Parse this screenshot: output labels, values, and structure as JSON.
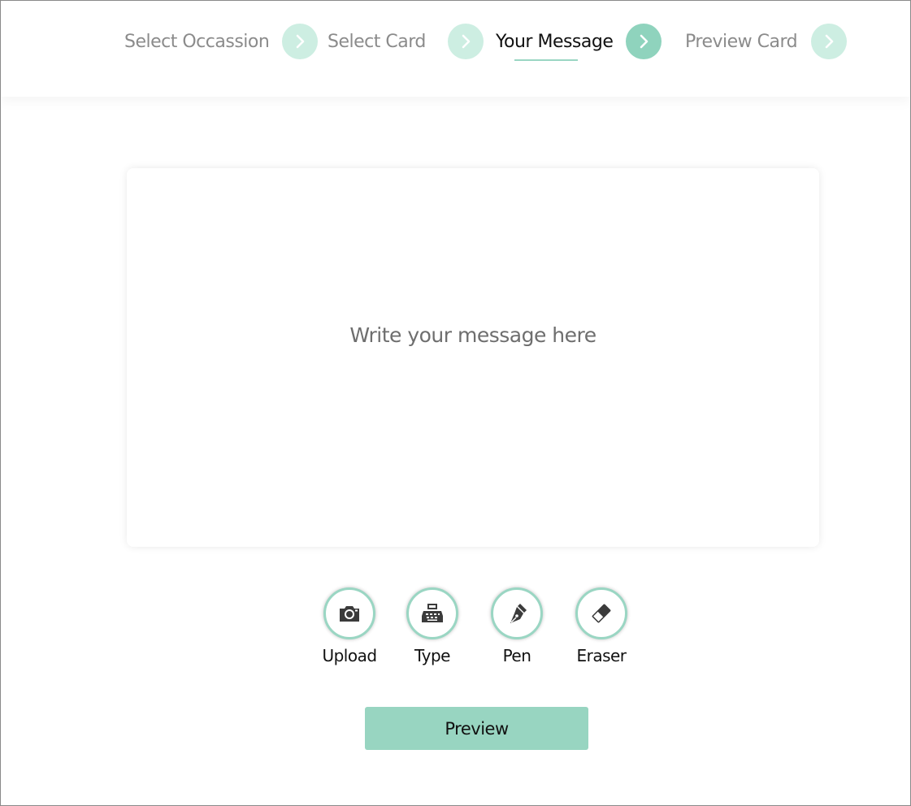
{
  "stepper": {
    "steps": [
      {
        "label": "Select Occassion",
        "state": "inactive"
      },
      {
        "label": "Select Card",
        "state": "inactive"
      },
      {
        "label": "Your Message",
        "state": "active"
      },
      {
        "label": "Preview Card",
        "state": "inactive"
      }
    ],
    "arrow_icon": "chevron-right-icon"
  },
  "message": {
    "placeholder": "Write your message here"
  },
  "tools": [
    {
      "label": "Upload",
      "icon": "camera-icon"
    },
    {
      "label": "Type",
      "icon": "typewriter-icon"
    },
    {
      "label": "Pen",
      "icon": "fountain-pen-icon"
    },
    {
      "label": "Eraser",
      "icon": "eraser-icon"
    }
  ],
  "actions": {
    "preview_label": "Preview"
  },
  "colors": {
    "accent": "#98d5c1",
    "accent_light": "#cdeee2",
    "active_arrow": "#8fd3bd",
    "inactive_text": "#8b8b8b",
    "active_text": "#111111"
  }
}
